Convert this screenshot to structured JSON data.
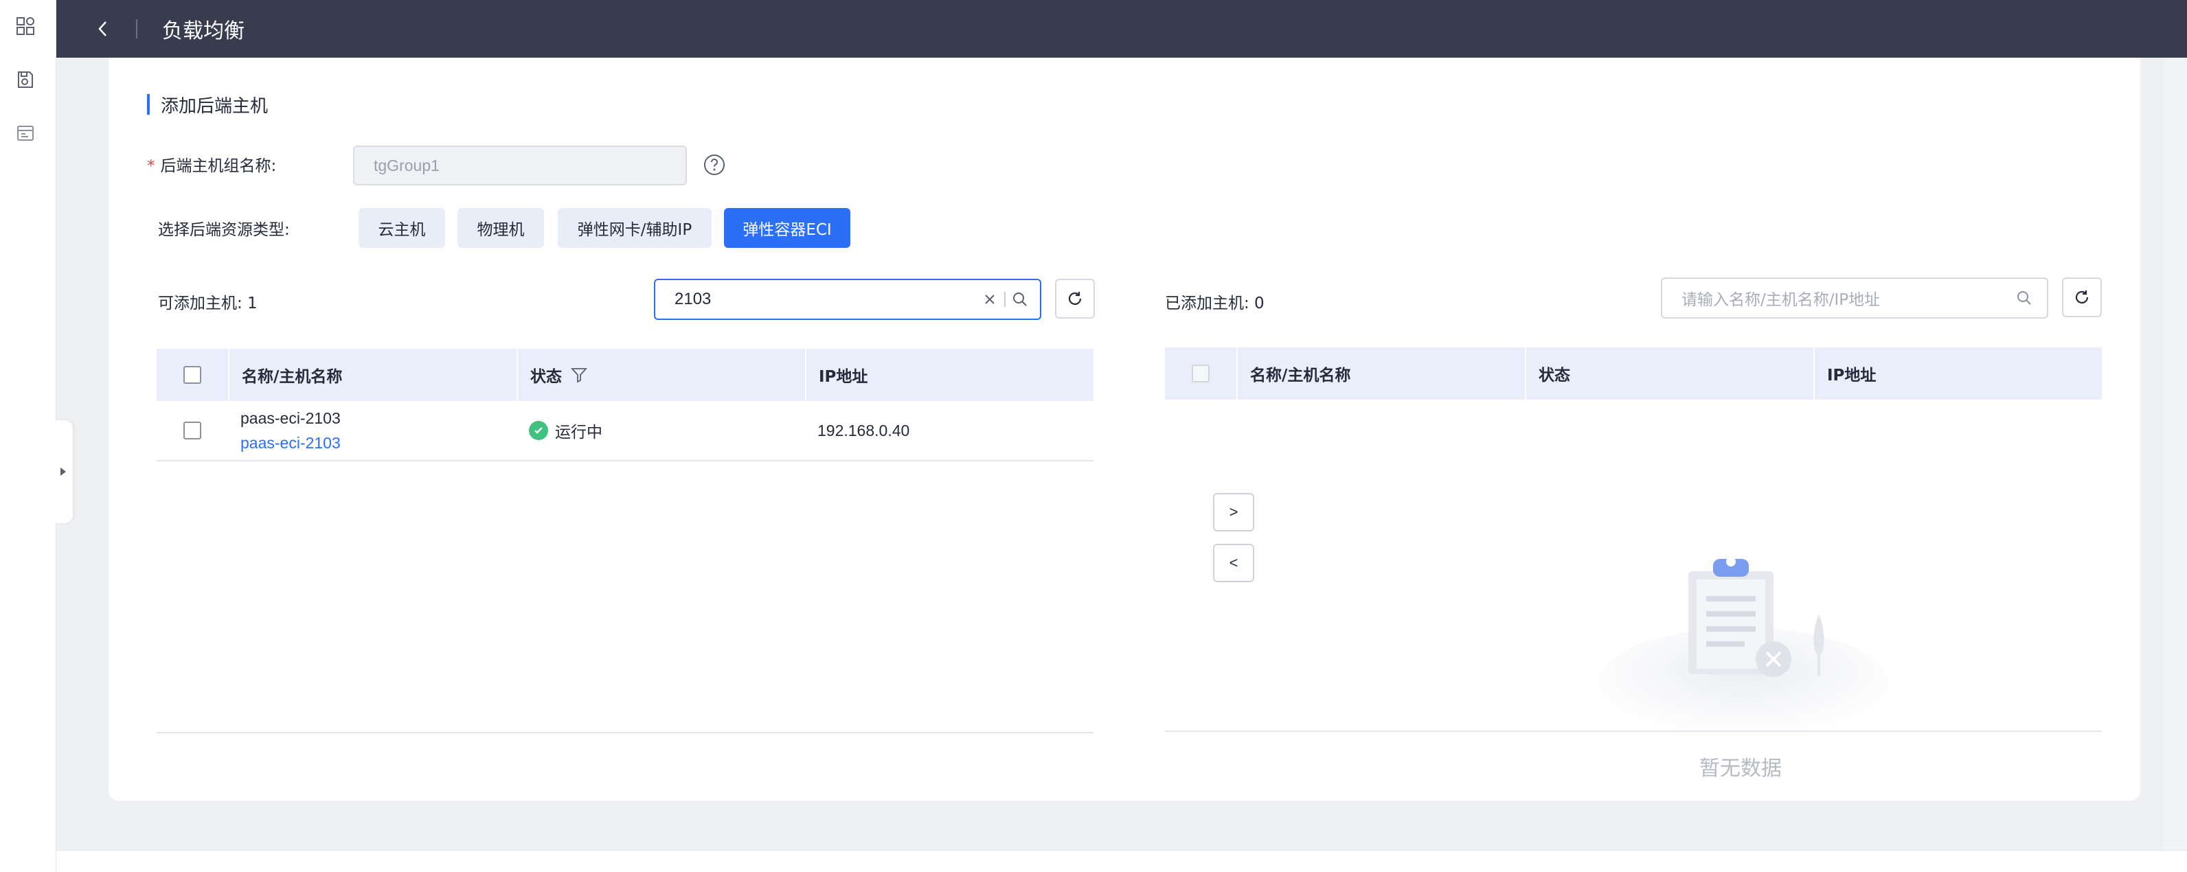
{
  "header": {
    "title": "负载均衡"
  },
  "rail": {
    "icons": [
      "apps-icon",
      "cloud-disk-icon",
      "resource-icon"
    ]
  },
  "section": {
    "title": "添加后端主机"
  },
  "form": {
    "group_name_label": "后端主机组名称:",
    "group_name_required_mark": "*",
    "group_name_value": "tgGroup1",
    "resource_type_label": "选择后端资源类型:",
    "resource_types": [
      {
        "label": "云主机",
        "active": false
      },
      {
        "label": "物理机",
        "active": false
      },
      {
        "label": "弹性网卡/辅助IP",
        "active": false
      },
      {
        "label": "弹性容器ECI",
        "active": true
      }
    ]
  },
  "available": {
    "count_label": "可添加主机: 1",
    "search_value": "2103",
    "columns": {
      "name": "名称/主机名称",
      "status": "状态",
      "ip": "IP地址"
    },
    "rows": [
      {
        "name": "paas-eci-2103",
        "host_name": "paas-eci-2103",
        "status": "运行中",
        "ip": "192.168.0.40"
      }
    ]
  },
  "added": {
    "count_label": "已添加主机: 0",
    "search_placeholder": "请输入名称/主机名称/IP地址",
    "columns": {
      "name": "名称/主机名称",
      "status": "状态",
      "ip": "IP地址"
    },
    "empty_text": "暂无数据"
  },
  "transfer": {
    "add_label": ">",
    "remove_label": "<"
  },
  "colors": {
    "accent": "#2a6ff5",
    "topbar": "#383c4f",
    "success": "#3fc27f",
    "table_header": "#eaeefb"
  }
}
